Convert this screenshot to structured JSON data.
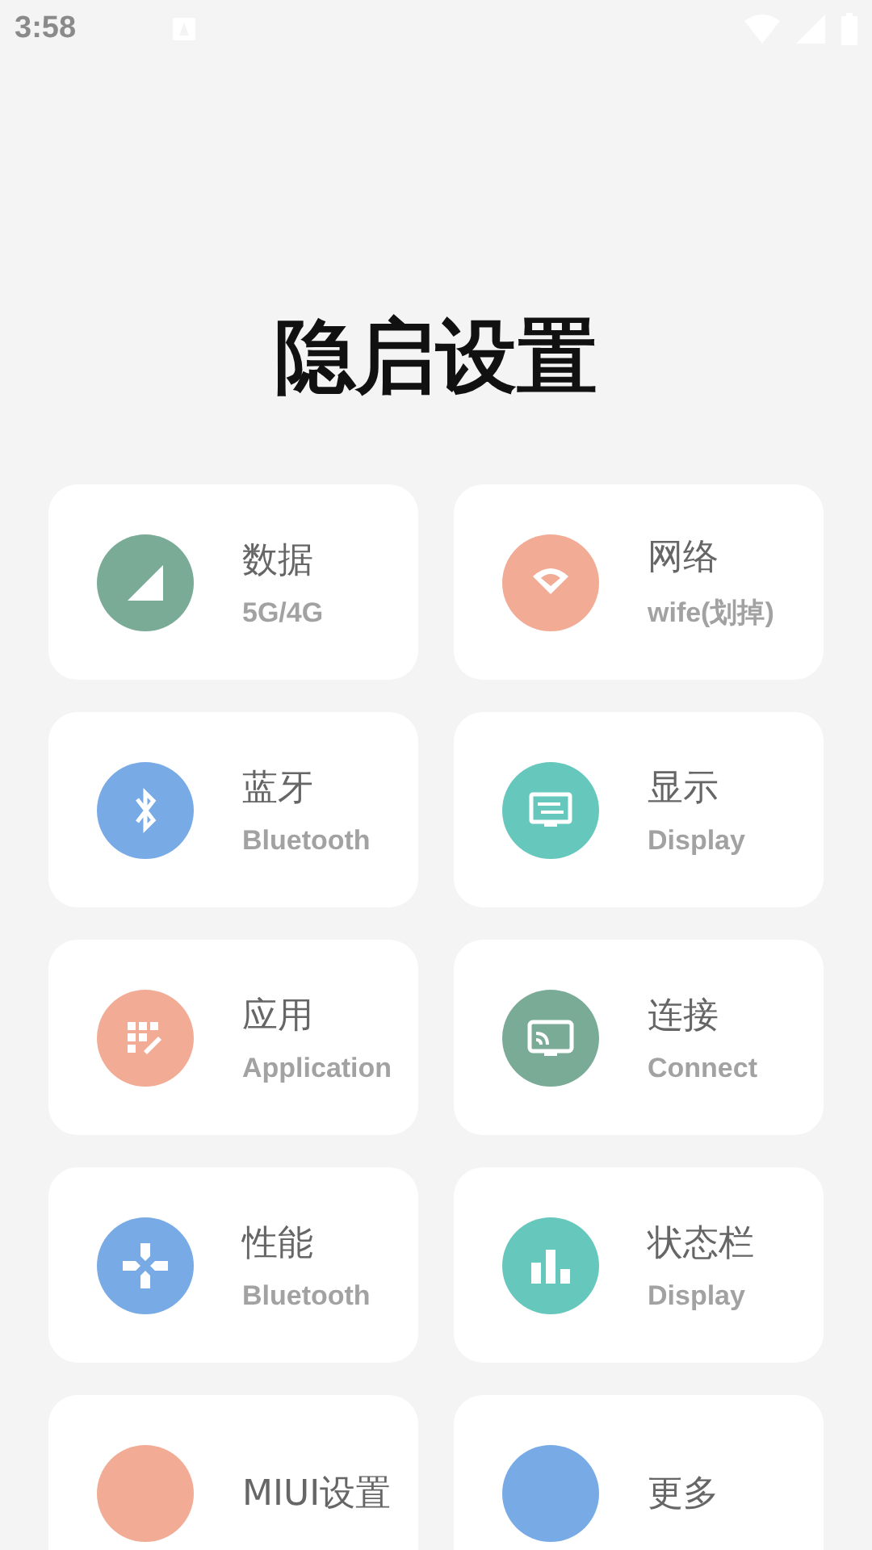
{
  "status_bar": {
    "time": "3:58"
  },
  "title": "隐启设置",
  "cards": [
    {
      "title": "数据",
      "subtitle": "5G/4G",
      "color": "#7aab97"
    },
    {
      "title": "网络",
      "subtitle": "wife(划掉)",
      "color": "#f2ab94"
    },
    {
      "title": "蓝牙",
      "subtitle": "Bluetooth",
      "color": "#78aae6"
    },
    {
      "title": "显示",
      "subtitle": "Display",
      "color": "#66c7bd"
    },
    {
      "title": "应用",
      "subtitle": "Application",
      "color": "#f2ab94"
    },
    {
      "title": "连接",
      "subtitle": "Connect",
      "color": "#7aab97"
    },
    {
      "title": "性能",
      "subtitle": "Bluetooth",
      "color": "#78aae6"
    },
    {
      "title": "状态栏",
      "subtitle": "Display",
      "color": "#66c7bd"
    },
    {
      "title": "MIUI设置",
      "color": "#f2ab94"
    },
    {
      "title": "更多",
      "color": "#78aae6"
    }
  ]
}
